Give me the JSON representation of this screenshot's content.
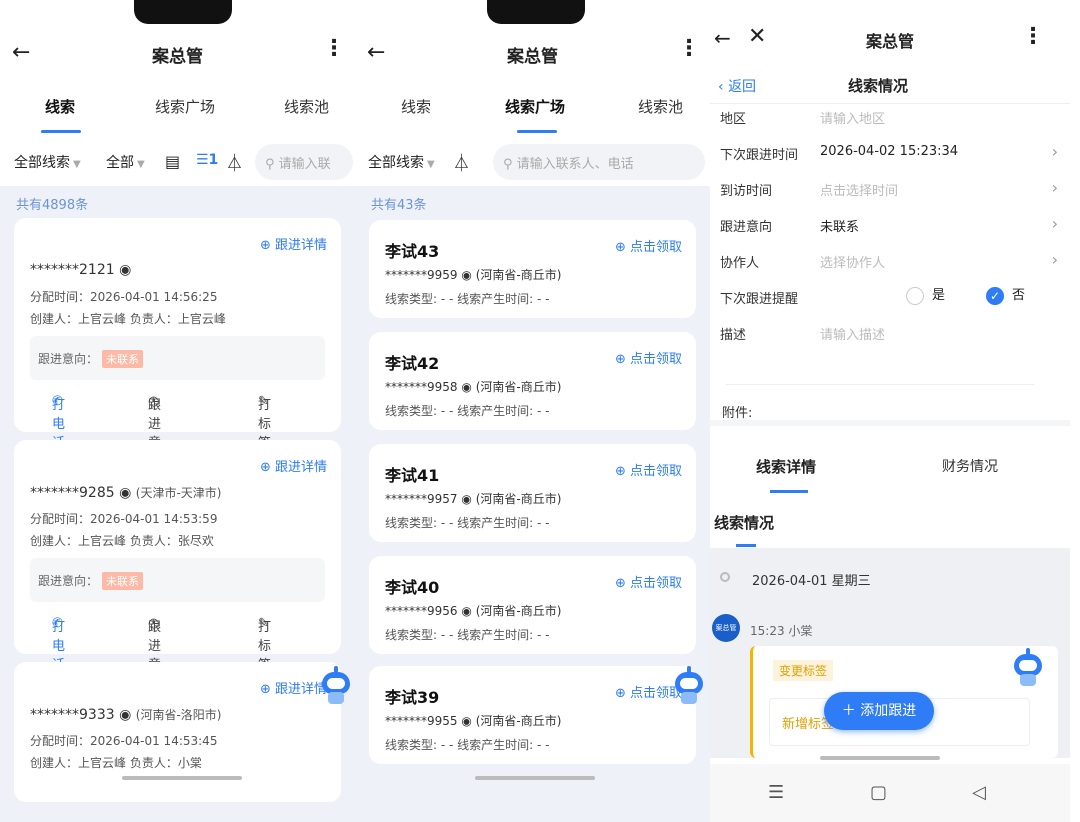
{
  "app_title": "案总管",
  "tabs": [
    "线索",
    "线索广场",
    "线索池"
  ],
  "panel1": {
    "filters": {
      "all_leads": "全部线索",
      "all": "全部",
      "search_placeholder": "请输入联"
    },
    "count": "共有4898条",
    "follow_link": "⊕ 跟进详情",
    "cards": [
      {
        "phone": "*******2121",
        "location": "",
        "assign_time": "分配时间：2026-04-01 14:56:25",
        "people": "创建人：上官云峰   负责人：上官云峰",
        "intent_label": "跟进意向：",
        "intent_value": "未联系"
      },
      {
        "phone": "*******9285",
        "location": "(天津市-天津市)",
        "assign_time": "分配时间：2026-04-01 14:53:59",
        "people": "创建人：上官云峰   负责人：张尽欢",
        "intent_label": "跟进意向：",
        "intent_value": "未联系"
      },
      {
        "phone": "*******9333",
        "location": "(河南省-洛阳市)",
        "assign_time": "分配时间：2026-04-01 14:53:45",
        "people": "创建人：上官云峰   负责人：小棠"
      }
    ],
    "actions": {
      "call": "打电话",
      "intent": "跟进意向",
      "tag": "打标签"
    }
  },
  "panel2": {
    "filters": {
      "all_leads": "全部线索",
      "search_placeholder": "请输入联系人、电话"
    },
    "count": "共有43条",
    "claim_link": "⊕ 点击领取",
    "type_line": "线索类型: - -   线索产生时间: - -",
    "cards": [
      {
        "name": "李试43",
        "phone": "*******9959",
        "location": "(河南省-商丘市)"
      },
      {
        "name": "李试42",
        "phone": "*******9958",
        "location": "(河南省-商丘市)"
      },
      {
        "name": "李试41",
        "phone": "*******9957",
        "location": "(河南省-商丘市)"
      },
      {
        "name": "李试40",
        "phone": "*******9956",
        "location": "(河南省-商丘市)"
      },
      {
        "name": "李试39",
        "phone": "*******9955",
        "location": "(河南省-商丘市)"
      }
    ]
  },
  "panel3": {
    "sub_back": "返回",
    "sub_title": "线索情况",
    "rows": [
      {
        "label": "地区",
        "placeholder": "请输入地区"
      },
      {
        "label": "下次跟进时间",
        "value": "2026-04-02 15:23:34"
      },
      {
        "label": "到访时间",
        "placeholder": "点击选择时间"
      },
      {
        "label": "跟进意向",
        "value": "未联系"
      },
      {
        "label": "协作人",
        "placeholder": "选择协作人"
      }
    ],
    "reminder_label": "下次跟进提醒",
    "yes": "是",
    "no": "否",
    "desc_label": "描述",
    "desc_placeholder": "请输入描述",
    "attach_label": "附件:",
    "detail_tabs": [
      "线索详情",
      "财务情况"
    ],
    "section_title": "线索情况",
    "timeline_date": "2026-04-01  星期三",
    "timeline_time": "15:23  小棠",
    "avatar_text": "案总管",
    "tag_label": "变更标签",
    "tag_content": "新增标签：[任锋退]",
    "fab": "添加跟进"
  }
}
